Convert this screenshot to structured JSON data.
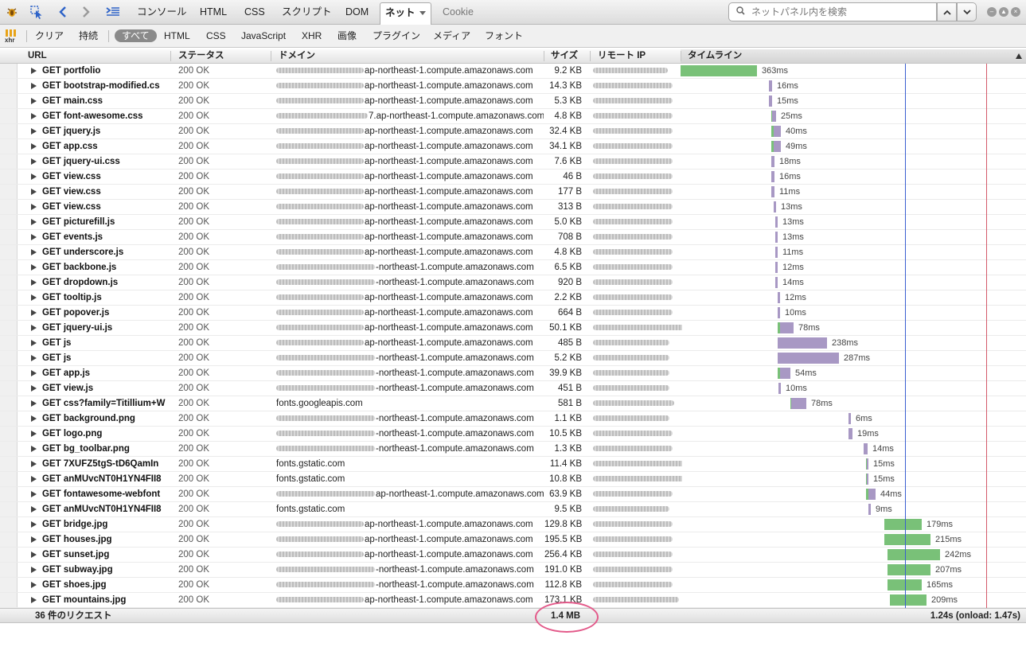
{
  "toolbar": {
    "tabs": [
      {
        "label": "コンソール"
      },
      {
        "label": "HTML"
      },
      {
        "label": "CSS"
      },
      {
        "label": "スクリプト"
      },
      {
        "label": "DOM"
      },
      {
        "label": "ネット",
        "active": true
      },
      {
        "label": "Cookie",
        "disabled": true
      }
    ],
    "search_placeholder": "ネットパネル内を検索"
  },
  "filter_bar": {
    "xhr_label": "xhr",
    "actions": [
      "クリア",
      "持続"
    ],
    "filters": [
      "すべて",
      "HTML",
      "CSS",
      "JavaScript",
      "XHR",
      "画像",
      "プラグイン",
      "メディア",
      "フォント"
    ],
    "selected_filter": "すべて"
  },
  "columns": {
    "url": "URL",
    "status": "ステータス",
    "domain": "ドメイン",
    "size": "サイズ",
    "remote_ip": "リモート IP",
    "timeline": "タイムライン"
  },
  "requests": [
    {
      "url": "GET portfolio",
      "status": "200 OK",
      "domain": "ap-northeast-1.compute.amazonaws.com",
      "size": "9.2 KB",
      "time": "363ms"
    },
    {
      "url": "GET bootstrap-modified.cs",
      "status": "200 OK",
      "domain": "ap-northeast-1.compute.amazonaws.com",
      "size": "14.3 KB",
      "time": "16ms"
    },
    {
      "url": "GET main.css",
      "status": "200 OK",
      "domain": "ap-northeast-1.compute.amazonaws.com",
      "size": "5.3 KB",
      "time": "15ms"
    },
    {
      "url": "GET font-awesome.css",
      "status": "200 OK",
      "domain": "7.ap-northeast-1.compute.amazonaws.com",
      "size": "4.8 KB",
      "time": "25ms"
    },
    {
      "url": "GET jquery.js",
      "status": "200 OK",
      "domain": "ap-northeast-1.compute.amazonaws.com",
      "size": "32.4 KB",
      "time": "40ms"
    },
    {
      "url": "GET app.css",
      "status": "200 OK",
      "domain": "ap-northeast-1.compute.amazonaws.com",
      "size": "34.1 KB",
      "time": "49ms"
    },
    {
      "url": "GET jquery-ui.css",
      "status": "200 OK",
      "domain": "ap-northeast-1.compute.amazonaws.com",
      "size": "7.6 KB",
      "time": "18ms"
    },
    {
      "url": "GET view.css",
      "status": "200 OK",
      "domain": "ap-northeast-1.compute.amazonaws.com",
      "size": "46 B",
      "time": "16ms"
    },
    {
      "url": "GET view.css",
      "status": "200 OK",
      "domain": "ap-northeast-1.compute.amazonaws.com",
      "size": "177 B",
      "time": "11ms"
    },
    {
      "url": "GET view.css",
      "status": "200 OK",
      "domain": "ap-northeast-1.compute.amazonaws.com",
      "size": "313 B",
      "time": "13ms"
    },
    {
      "url": "GET picturefill.js",
      "status": "200 OK",
      "domain": "ap-northeast-1.compute.amazonaws.com",
      "size": "5.0 KB",
      "time": "13ms"
    },
    {
      "url": "GET events.js",
      "status": "200 OK",
      "domain": "ap-northeast-1.compute.amazonaws.com",
      "size": "708 B",
      "time": "13ms"
    },
    {
      "url": "GET underscore.js",
      "status": "200 OK",
      "domain": "ap-northeast-1.compute.amazonaws.com",
      "size": "4.8 KB",
      "time": "11ms"
    },
    {
      "url": "GET backbone.js",
      "status": "200 OK",
      "domain": "-northeast-1.compute.amazonaws.com",
      "size": "6.5 KB",
      "time": "12ms"
    },
    {
      "url": "GET dropdown.js",
      "status": "200 OK",
      "domain": "-northeast-1.compute.amazonaws.com",
      "size": "920 B",
      "time": "14ms"
    },
    {
      "url": "GET tooltip.js",
      "status": "200 OK",
      "domain": "ap-northeast-1.compute.amazonaws.com",
      "size": "2.2 KB",
      "time": "12ms"
    },
    {
      "url": "GET popover.js",
      "status": "200 OK",
      "domain": "ap-northeast-1.compute.amazonaws.com",
      "size": "664 B",
      "time": "10ms"
    },
    {
      "url": "GET jquery-ui.js",
      "status": "200 OK",
      "domain": "ap-northeast-1.compute.amazonaws.com",
      "size": "50.1 KB",
      "time": "78ms"
    },
    {
      "url": "GET js",
      "status": "200 OK",
      "domain": "ap-northeast-1.compute.amazonaws.com",
      "size": "485 B",
      "time": "238ms"
    },
    {
      "url": "GET js",
      "status": "200 OK",
      "domain": "-northeast-1.compute.amazonaws.com",
      "size": "5.2 KB",
      "time": "287ms"
    },
    {
      "url": "GET app.js",
      "status": "200 OK",
      "domain": "-northeast-1.compute.amazonaws.com",
      "size": "39.9 KB",
      "time": "54ms"
    },
    {
      "url": "GET view.js",
      "status": "200 OK",
      "domain": "-northeast-1.compute.amazonaws.com",
      "size": "451 B",
      "time": "10ms"
    },
    {
      "url": "GET css?family=Titillium+W",
      "status": "200 OK",
      "domain": "fonts.googleapis.com",
      "size": "581 B",
      "time": "78ms"
    },
    {
      "url": "GET background.png",
      "status": "200 OK",
      "domain": "-northeast-1.compute.amazonaws.com",
      "size": "1.1 KB",
      "time": "6ms"
    },
    {
      "url": "GET logo.png",
      "status": "200 OK",
      "domain": "-northeast-1.compute.amazonaws.com",
      "size": "10.5 KB",
      "time": "19ms"
    },
    {
      "url": "GET bg_toolbar.png",
      "status": "200 OK",
      "domain": "-northeast-1.compute.amazonaws.com",
      "size": "1.3 KB",
      "time": "14ms"
    },
    {
      "url": "GET 7XUFZ5tgS-tD6QamIn",
      "status": "200 OK",
      "domain": "fonts.gstatic.com",
      "size": "11.4 KB",
      "time": "15ms"
    },
    {
      "url": "GET anMUvcNT0H1YN4FII8",
      "status": "200 OK",
      "domain": "fonts.gstatic.com",
      "size": "10.8 KB",
      "time": "15ms"
    },
    {
      "url": "GET fontawesome-webfont",
      "status": "200 OK",
      "domain": "ap-northeast-1.compute.amazonaws.com",
      "size": "63.9 KB",
      "time": "44ms"
    },
    {
      "url": "GET anMUvcNT0H1YN4FII8",
      "status": "200 OK",
      "domain": "fonts.gstatic.com",
      "size": "9.5 KB",
      "time": "9ms"
    },
    {
      "url": "GET bridge.jpg",
      "status": "200 OK",
      "domain": "ap-northeast-1.compute.amazonaws.com",
      "size": "129.8 KB",
      "time": "179ms"
    },
    {
      "url": "GET houses.jpg",
      "status": "200 OK",
      "domain": "ap-northeast-1.compute.amazonaws.com",
      "size": "195.5 KB",
      "time": "215ms"
    },
    {
      "url": "GET sunset.jpg",
      "status": "200 OK",
      "domain": "ap-northeast-1.compute.amazonaws.com",
      "size": "256.4 KB",
      "time": "242ms"
    },
    {
      "url": "GET subway.jpg",
      "status": "200 OK",
      "domain": "-northeast-1.compute.amazonaws.com",
      "size": "191.0 KB",
      "time": "207ms"
    },
    {
      "url": "GET shoes.jpg",
      "status": "200 OK",
      "domain": "-northeast-1.compute.amazonaws.com",
      "size": "112.8 KB",
      "time": "165ms"
    },
    {
      "url": "GET mountains.jpg",
      "status": "200 OK",
      "domain": "ap-northeast-1.compute.amazonaws.com",
      "size": "173.1 KB",
      "time": "209ms"
    }
  ],
  "summary": {
    "request_count": "36 件のリクエスト",
    "total_size": "1.4 MB",
    "total_time": "1.24s (onload: 1.47s)"
  },
  "colors": {
    "wait": "#a898c4",
    "receive": "#79c178",
    "dom_content_loaded_line": "#3a5fd0",
    "onload_line": "#d35a6a",
    "highlight_ring": "#e35a8a"
  }
}
